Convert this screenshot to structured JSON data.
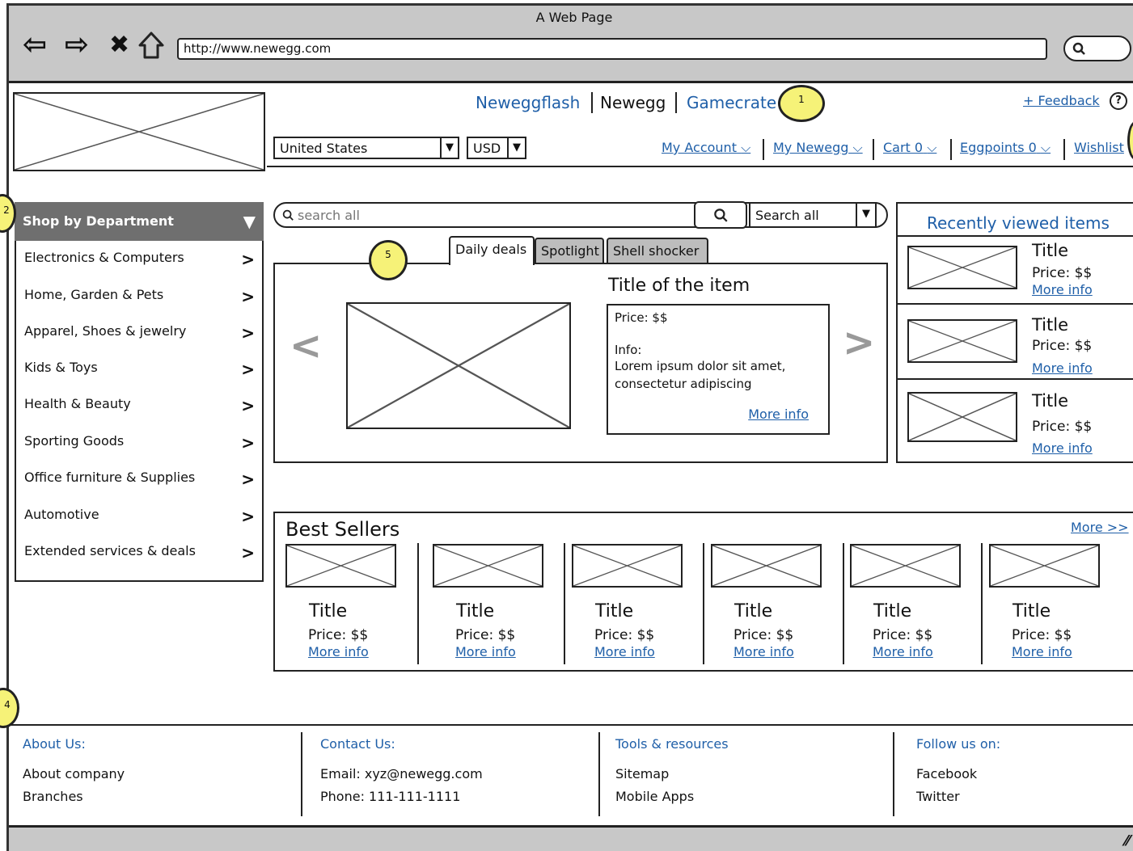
{
  "window": {
    "title": "A Web Page",
    "url": "http://www.newegg.com"
  },
  "header": {
    "sites": [
      "Neweggflash",
      "Newegg",
      "Gamecrate"
    ],
    "feedback": "+ Feedback",
    "help_icon": "?",
    "country": "United States",
    "currency": "USD",
    "account_links": [
      "My Account",
      "My Newegg",
      "Cart 0",
      "Eggpoints 0",
      "Wishlist"
    ]
  },
  "sidebar": {
    "title": "Shop by Department",
    "items": [
      "Electronics & Computers",
      "Home, Garden & Pets",
      "Apparel, Shoes & jewelry",
      "Kids & Toys",
      "Health & Beauty",
      "Sporting Goods",
      "Office furniture & Supplies",
      "Automotive",
      "Extended services & deals"
    ]
  },
  "search": {
    "placeholder": "search all",
    "scope": "Search all"
  },
  "tabs": [
    "Daily deals",
    "Spotlight",
    "Shell shocker"
  ],
  "deal": {
    "title": "Title of the item",
    "price": "Price: $$",
    "info_label": "Info:",
    "info_text": "Lorem ipsum dolor sit amet, consectetur adipiscing",
    "more": "More info"
  },
  "recent": {
    "heading": "Recently viewed items",
    "items": [
      {
        "title": "Title",
        "price": "Price: $$",
        "more": "More info"
      },
      {
        "title": "Title",
        "price": "Price: $$",
        "more": "More info"
      },
      {
        "title": "Title",
        "price": "Price: $$",
        "more": "More info"
      }
    ]
  },
  "best": {
    "heading": "Best Sellers",
    "more": "More >>",
    "items": [
      {
        "title": "Title",
        "price": "Price: $$",
        "more": "More info"
      },
      {
        "title": "Title",
        "price": "Price: $$",
        "more": "More info"
      },
      {
        "title": "Title",
        "price": "Price: $$",
        "more": "More info"
      },
      {
        "title": "Title",
        "price": "Price: $$",
        "more": "More info"
      },
      {
        "title": "Title",
        "price": "Price: $$",
        "more": "More info"
      },
      {
        "title": "Title",
        "price": "Price: $$",
        "more": "More info"
      }
    ]
  },
  "footer": {
    "columns": [
      {
        "heading": "About Us:",
        "items": [
          "About company",
          "Branches"
        ]
      },
      {
        "heading": "Contact Us:",
        "items": [
          "Email: xyz@newegg.com",
          "Phone: 111-111-1111"
        ]
      },
      {
        "heading": "Tools & resources",
        "items": [
          "Sitemap",
          "Mobile Apps"
        ]
      },
      {
        "heading": "Follow us on:",
        "items": [
          "Facebook",
          "Twitter"
        ]
      }
    ]
  },
  "callouts": [
    "1",
    "2",
    "4",
    "5"
  ],
  "colors": {
    "link": "#1f5fa8",
    "callout": "#f6f278",
    "chrome": "#c8c8c8",
    "dept_header": "#6f6f6f"
  }
}
